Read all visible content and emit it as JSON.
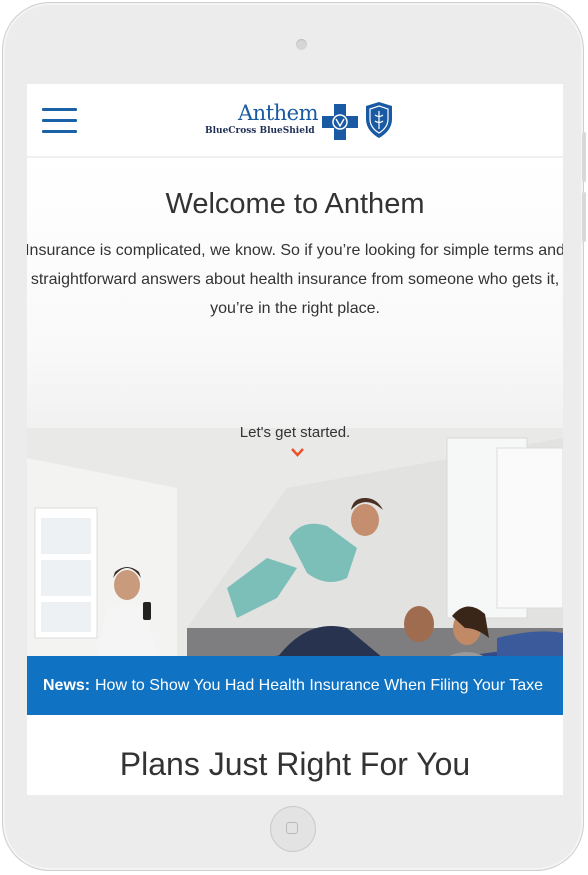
{
  "header": {
    "logo": {
      "brand": "Anthem",
      "subbrand": "BlueCross BlueShield"
    },
    "menu_icon": "hamburger-menu-icon"
  },
  "hero": {
    "title": "Welcome to Anthem",
    "text": "Insurance is complicated, we know. So if you’re looking for simple terms and straightforward answers about health insurance from someone who gets it, you’re in the right place.",
    "cta": "Let's get started.",
    "cta_icon": "chevron-down-icon"
  },
  "news": {
    "label": "News:",
    "headline": "How to Show You Had Health Insurance When Filing Your Taxe"
  },
  "plans": {
    "title": "Plans Just Right For You"
  },
  "colors": {
    "brand_blue": "#1a62a8",
    "news_bar": "#0f72c2",
    "accent_orange": "#e8542b",
    "text": "#333333"
  }
}
